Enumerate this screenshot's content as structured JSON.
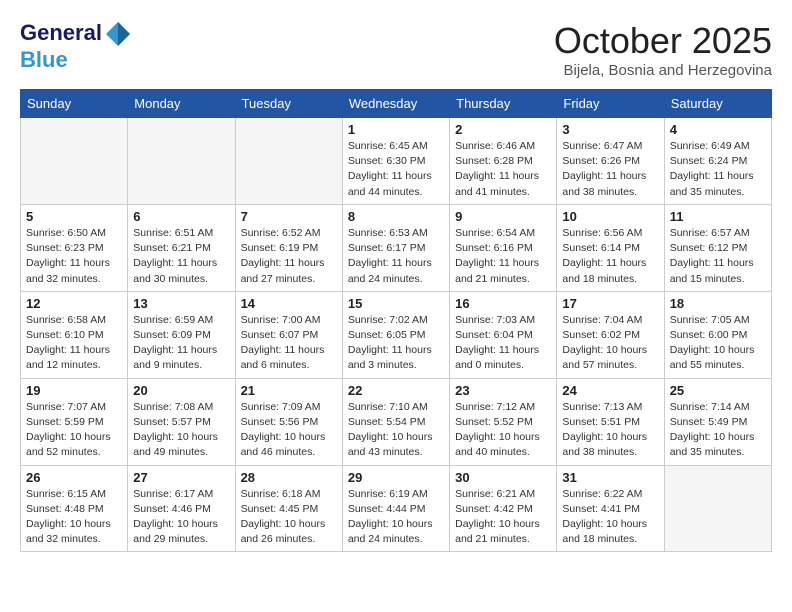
{
  "logo": {
    "line1": "General",
    "line2": "Blue"
  },
  "title": "October 2025",
  "subtitle": "Bijela, Bosnia and Herzegovina",
  "days_of_week": [
    "Sunday",
    "Monday",
    "Tuesday",
    "Wednesday",
    "Thursday",
    "Friday",
    "Saturday"
  ],
  "weeks": [
    [
      {
        "day": "",
        "info": ""
      },
      {
        "day": "",
        "info": ""
      },
      {
        "day": "",
        "info": ""
      },
      {
        "day": "1",
        "info": "Sunrise: 6:45 AM\nSunset: 6:30 PM\nDaylight: 11 hours\nand 44 minutes."
      },
      {
        "day": "2",
        "info": "Sunrise: 6:46 AM\nSunset: 6:28 PM\nDaylight: 11 hours\nand 41 minutes."
      },
      {
        "day": "3",
        "info": "Sunrise: 6:47 AM\nSunset: 6:26 PM\nDaylight: 11 hours\nand 38 minutes."
      },
      {
        "day": "4",
        "info": "Sunrise: 6:49 AM\nSunset: 6:24 PM\nDaylight: 11 hours\nand 35 minutes."
      }
    ],
    [
      {
        "day": "5",
        "info": "Sunrise: 6:50 AM\nSunset: 6:23 PM\nDaylight: 11 hours\nand 32 minutes."
      },
      {
        "day": "6",
        "info": "Sunrise: 6:51 AM\nSunset: 6:21 PM\nDaylight: 11 hours\nand 30 minutes."
      },
      {
        "day": "7",
        "info": "Sunrise: 6:52 AM\nSunset: 6:19 PM\nDaylight: 11 hours\nand 27 minutes."
      },
      {
        "day": "8",
        "info": "Sunrise: 6:53 AM\nSunset: 6:17 PM\nDaylight: 11 hours\nand 24 minutes."
      },
      {
        "day": "9",
        "info": "Sunrise: 6:54 AM\nSunset: 6:16 PM\nDaylight: 11 hours\nand 21 minutes."
      },
      {
        "day": "10",
        "info": "Sunrise: 6:56 AM\nSunset: 6:14 PM\nDaylight: 11 hours\nand 18 minutes."
      },
      {
        "day": "11",
        "info": "Sunrise: 6:57 AM\nSunset: 6:12 PM\nDaylight: 11 hours\nand 15 minutes."
      }
    ],
    [
      {
        "day": "12",
        "info": "Sunrise: 6:58 AM\nSunset: 6:10 PM\nDaylight: 11 hours\nand 12 minutes."
      },
      {
        "day": "13",
        "info": "Sunrise: 6:59 AM\nSunset: 6:09 PM\nDaylight: 11 hours\nand 9 minutes."
      },
      {
        "day": "14",
        "info": "Sunrise: 7:00 AM\nSunset: 6:07 PM\nDaylight: 11 hours\nand 6 minutes."
      },
      {
        "day": "15",
        "info": "Sunrise: 7:02 AM\nSunset: 6:05 PM\nDaylight: 11 hours\nand 3 minutes."
      },
      {
        "day": "16",
        "info": "Sunrise: 7:03 AM\nSunset: 6:04 PM\nDaylight: 11 hours\nand 0 minutes."
      },
      {
        "day": "17",
        "info": "Sunrise: 7:04 AM\nSunset: 6:02 PM\nDaylight: 10 hours\nand 57 minutes."
      },
      {
        "day": "18",
        "info": "Sunrise: 7:05 AM\nSunset: 6:00 PM\nDaylight: 10 hours\nand 55 minutes."
      }
    ],
    [
      {
        "day": "19",
        "info": "Sunrise: 7:07 AM\nSunset: 5:59 PM\nDaylight: 10 hours\nand 52 minutes."
      },
      {
        "day": "20",
        "info": "Sunrise: 7:08 AM\nSunset: 5:57 PM\nDaylight: 10 hours\nand 49 minutes."
      },
      {
        "day": "21",
        "info": "Sunrise: 7:09 AM\nSunset: 5:56 PM\nDaylight: 10 hours\nand 46 minutes."
      },
      {
        "day": "22",
        "info": "Sunrise: 7:10 AM\nSunset: 5:54 PM\nDaylight: 10 hours\nand 43 minutes."
      },
      {
        "day": "23",
        "info": "Sunrise: 7:12 AM\nSunset: 5:52 PM\nDaylight: 10 hours\nand 40 minutes."
      },
      {
        "day": "24",
        "info": "Sunrise: 7:13 AM\nSunset: 5:51 PM\nDaylight: 10 hours\nand 38 minutes."
      },
      {
        "day": "25",
        "info": "Sunrise: 7:14 AM\nSunset: 5:49 PM\nDaylight: 10 hours\nand 35 minutes."
      }
    ],
    [
      {
        "day": "26",
        "info": "Sunrise: 6:15 AM\nSunset: 4:48 PM\nDaylight: 10 hours\nand 32 minutes."
      },
      {
        "day": "27",
        "info": "Sunrise: 6:17 AM\nSunset: 4:46 PM\nDaylight: 10 hours\nand 29 minutes."
      },
      {
        "day": "28",
        "info": "Sunrise: 6:18 AM\nSunset: 4:45 PM\nDaylight: 10 hours\nand 26 minutes."
      },
      {
        "day": "29",
        "info": "Sunrise: 6:19 AM\nSunset: 4:44 PM\nDaylight: 10 hours\nand 24 minutes."
      },
      {
        "day": "30",
        "info": "Sunrise: 6:21 AM\nSunset: 4:42 PM\nDaylight: 10 hours\nand 21 minutes."
      },
      {
        "day": "31",
        "info": "Sunrise: 6:22 AM\nSunset: 4:41 PM\nDaylight: 10 hours\nand 18 minutes."
      },
      {
        "day": "",
        "info": ""
      }
    ]
  ]
}
